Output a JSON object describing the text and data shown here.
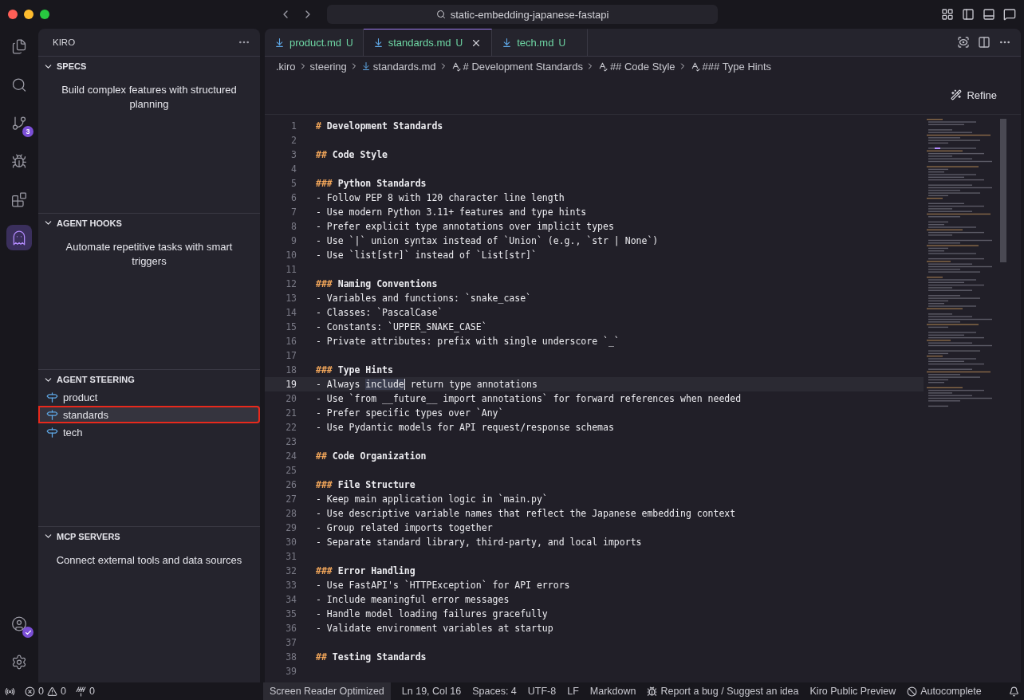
{
  "window": {
    "title": "static-embedding-japanese-fastapi"
  },
  "activity_bar": {
    "items": [
      {
        "kind": "files",
        "selected": false
      },
      {
        "kind": "search",
        "selected": false
      },
      {
        "kind": "source-control",
        "selected": false,
        "badge": "3"
      },
      {
        "kind": "debug",
        "selected": false
      },
      {
        "kind": "extensions",
        "selected": false
      },
      {
        "kind": "kiro",
        "selected": true
      }
    ],
    "bottom": [
      {
        "kind": "account"
      },
      {
        "kind": "settings"
      }
    ]
  },
  "sidebar": {
    "title": "KIRO",
    "sections": [
      {
        "title": "SPECS",
        "expanded": true,
        "description": "Build complex features with structured planning"
      },
      {
        "title": "AGENT HOOKS",
        "expanded": true,
        "description": "Automate repetitive tasks with smart triggers"
      },
      {
        "title": "AGENT STEERING",
        "expanded": true,
        "items": [
          {
            "label": "product",
            "selected": false,
            "outlined": false
          },
          {
            "label": "standards",
            "selected": true,
            "outlined": true
          },
          {
            "label": "tech",
            "selected": false,
            "outlined": false
          }
        ]
      },
      {
        "title": "MCP SERVERS",
        "expanded": true,
        "description": "Connect external tools and data sources"
      }
    ]
  },
  "tabs": [
    {
      "label": "product.md",
      "status": "U",
      "selected": false
    },
    {
      "label": "standards.md",
      "status": "U",
      "selected": true
    },
    {
      "label": "tech.md",
      "status": "U",
      "selected": false
    }
  ],
  "breadcrumb": [
    {
      "kind": "folder",
      "label": ".kiro"
    },
    {
      "kind": "folder",
      "label": "steering"
    },
    {
      "kind": "file",
      "label": "standards.md"
    },
    {
      "kind": "symbol",
      "label": "# Development Standards"
    },
    {
      "kind": "symbol",
      "label": "## Code Style"
    },
    {
      "kind": "symbol",
      "label": "### Type Hints"
    }
  ],
  "refine_button": "Refine",
  "editor": {
    "lines": [
      {
        "number": "1",
        "kind": "heading",
        "marker": "#",
        "text": "Development Standards"
      },
      {
        "number": "2",
        "kind": "blank"
      },
      {
        "number": "3",
        "kind": "heading",
        "marker": "##",
        "text": "Code Style"
      },
      {
        "number": "4",
        "kind": "blank"
      },
      {
        "number": "5",
        "kind": "heading",
        "marker": "###",
        "text": "Python Standards"
      },
      {
        "number": "6",
        "kind": "text",
        "text": "- Follow PEP 8 with 120 character line length"
      },
      {
        "number": "7",
        "kind": "text",
        "text": "- Use modern Python 3.11+ features and type hints"
      },
      {
        "number": "8",
        "kind": "text",
        "text": "- Prefer explicit type annotations over implicit types"
      },
      {
        "number": "9",
        "kind": "text",
        "text": "- Use `|` union syntax instead of `Union` (e.g., `str | None`)"
      },
      {
        "number": "10",
        "kind": "text",
        "text": "- Use `list[str]` instead of `List[str]`"
      },
      {
        "number": "11",
        "kind": "blank"
      },
      {
        "number": "12",
        "kind": "heading",
        "marker": "###",
        "text": "Naming Conventions"
      },
      {
        "number": "13",
        "kind": "text",
        "text": "- Variables and functions: `snake_case`"
      },
      {
        "number": "14",
        "kind": "text",
        "text": "- Classes: `PascalCase`"
      },
      {
        "number": "15",
        "kind": "text",
        "text": "- Constants: `UPPER_SNAKE_CASE`"
      },
      {
        "number": "16",
        "kind": "text",
        "text": "- Private attributes: prefix with single underscore `_`"
      },
      {
        "number": "17",
        "kind": "blank"
      },
      {
        "number": "18",
        "kind": "heading",
        "marker": "###",
        "text": "Type Hints"
      },
      {
        "number": "19",
        "kind": "text",
        "current": true,
        "text": "- Always ",
        "selection": "include",
        "after": " return type annotations"
      },
      {
        "number": "20",
        "kind": "text",
        "text": "- Use `from __future__ import annotations` for forward references when needed"
      },
      {
        "number": "21",
        "kind": "text",
        "text": "- Prefer specific types over `Any`"
      },
      {
        "number": "22",
        "kind": "text",
        "text": "- Use Pydantic models for API request/response schemas"
      },
      {
        "number": "23",
        "kind": "blank"
      },
      {
        "number": "24",
        "kind": "heading",
        "marker": "##",
        "text": "Code Organization"
      },
      {
        "number": "25",
        "kind": "blank"
      },
      {
        "number": "26",
        "kind": "heading",
        "marker": "###",
        "text": "File Structure"
      },
      {
        "number": "27",
        "kind": "text",
        "text": "- Keep main application logic in `main.py`"
      },
      {
        "number": "28",
        "kind": "text",
        "text": "- Use descriptive variable names that reflect the Japanese embedding context"
      },
      {
        "number": "29",
        "kind": "text",
        "text": "- Group related imports together"
      },
      {
        "number": "30",
        "kind": "text",
        "text": "- Separate standard library, third-party, and local imports"
      },
      {
        "number": "31",
        "kind": "blank"
      },
      {
        "number": "32",
        "kind": "heading",
        "marker": "###",
        "text": "Error Handling"
      },
      {
        "number": "33",
        "kind": "text",
        "text": "- Use FastAPI's `HTTPException` for API errors"
      },
      {
        "number": "34",
        "kind": "text",
        "text": "- Include meaningful error messages"
      },
      {
        "number": "35",
        "kind": "text",
        "text": "- Handle model loading failures gracefully"
      },
      {
        "number": "36",
        "kind": "text",
        "text": "- Validate environment variables at startup"
      },
      {
        "number": "37",
        "kind": "blank"
      },
      {
        "number": "38",
        "kind": "heading",
        "marker": "##",
        "text": "Testing Standards"
      },
      {
        "number": "39",
        "kind": "blank"
      }
    ]
  },
  "status_bar": {
    "errors": "0",
    "warnings": "0",
    "ports": "0",
    "items": [
      {
        "kind": "highlight",
        "label": "Screen Reader Optimized"
      },
      {
        "kind": "plain",
        "label": "Ln 19, Col 16"
      },
      {
        "kind": "plain",
        "label": "Spaces: 4"
      },
      {
        "kind": "plain",
        "label": "UTF-8"
      },
      {
        "kind": "plain",
        "label": "LF"
      },
      {
        "kind": "plain",
        "label": "Markdown"
      },
      {
        "kind": "bug",
        "label": "Report a bug / Suggest an idea"
      },
      {
        "kind": "plain",
        "label": "Kiro Public Preview"
      },
      {
        "kind": "blocked",
        "label": "Autocomplete"
      }
    ]
  }
}
